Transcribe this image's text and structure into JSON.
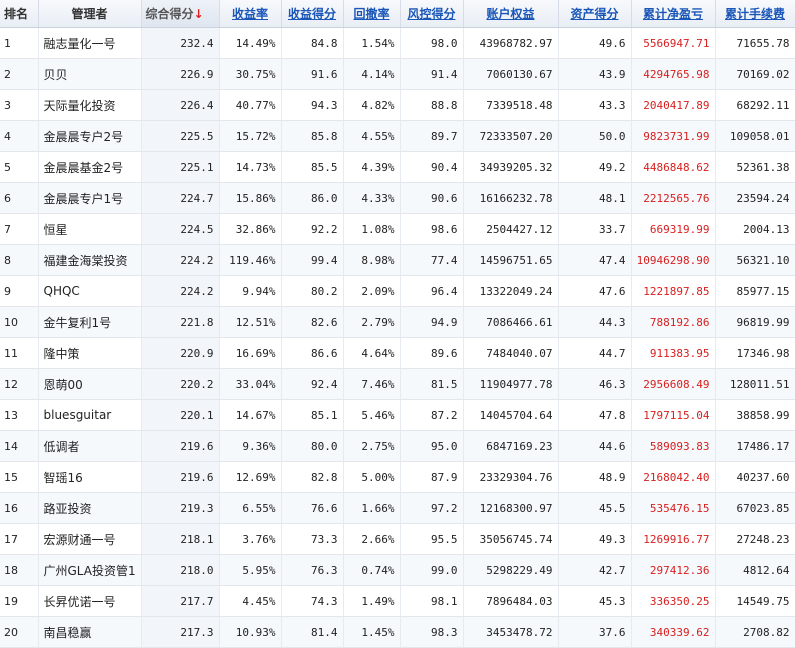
{
  "headers": {
    "rank": "排名",
    "manager": "管理者",
    "total_score": "综合得分",
    "sort_arrow": "↓",
    "return_rate": "收益率",
    "return_score": "收益得分",
    "drawdown": "回撤率",
    "risk_score": "风控得分",
    "equity": "账户权益",
    "asset_score": "资产得分",
    "cum_pnl": "累计净盈亏",
    "cum_fee": "累计手续费"
  },
  "colors": {
    "link": "#1a56b8",
    "profit": "#d81e1e",
    "arrow": "#e02020"
  },
  "rows": [
    {
      "rank": "1",
      "manager": "融志量化一号",
      "total": "232.4",
      "ret": "14.49%",
      "ret_score": "84.8",
      "dd": "1.54%",
      "risk": "98.0",
      "equity": "43968782.97",
      "asset": "49.6",
      "pnl": "5566947.71",
      "fee": "71655.78"
    },
    {
      "rank": "2",
      "manager": "贝贝",
      "total": "226.9",
      "ret": "30.75%",
      "ret_score": "91.6",
      "dd": "4.14%",
      "risk": "91.4",
      "equity": "7060130.67",
      "asset": "43.9",
      "pnl": "4294765.98",
      "fee": "70169.02"
    },
    {
      "rank": "3",
      "manager": "天际量化投资",
      "total": "226.4",
      "ret": "40.77%",
      "ret_score": "94.3",
      "dd": "4.82%",
      "risk": "88.8",
      "equity": "7339518.48",
      "asset": "43.3",
      "pnl": "2040417.89",
      "fee": "68292.11"
    },
    {
      "rank": "4",
      "manager": "金晨晨专户2号",
      "total": "225.5",
      "ret": "15.72%",
      "ret_score": "85.8",
      "dd": "4.55%",
      "risk": "89.7",
      "equity": "72333507.20",
      "asset": "50.0",
      "pnl": "9823731.99",
      "fee": "109058.01"
    },
    {
      "rank": "5",
      "manager": "金晨晨基金2号",
      "total": "225.1",
      "ret": "14.73%",
      "ret_score": "85.5",
      "dd": "4.39%",
      "risk": "90.4",
      "equity": "34939205.32",
      "asset": "49.2",
      "pnl": "4486848.62",
      "fee": "52361.38"
    },
    {
      "rank": "6",
      "manager": "金晨晨专户1号",
      "total": "224.7",
      "ret": "15.86%",
      "ret_score": "86.0",
      "dd": "4.33%",
      "risk": "90.6",
      "equity": "16166232.78",
      "asset": "48.1",
      "pnl": "2212565.76",
      "fee": "23594.24"
    },
    {
      "rank": "7",
      "manager": "恒星",
      "total": "224.5",
      "ret": "32.86%",
      "ret_score": "92.2",
      "dd": "1.08%",
      "risk": "98.6",
      "equity": "2504427.12",
      "asset": "33.7",
      "pnl": "669319.99",
      "fee": "2004.13"
    },
    {
      "rank": "8",
      "manager": "福建金海棠投资",
      "total": "224.2",
      "ret": "119.46%",
      "ret_score": "99.4",
      "dd": "8.98%",
      "risk": "77.4",
      "equity": "14596751.65",
      "asset": "47.4",
      "pnl": "10946298.90",
      "fee": "56321.10"
    },
    {
      "rank": "9",
      "manager": "QHQC",
      "total": "224.2",
      "ret": "9.94%",
      "ret_score": "80.2",
      "dd": "2.09%",
      "risk": "96.4",
      "equity": "13322049.24",
      "asset": "47.6",
      "pnl": "1221897.85",
      "fee": "85977.15"
    },
    {
      "rank": "10",
      "manager": "金牛复利1号",
      "total": "221.8",
      "ret": "12.51%",
      "ret_score": "82.6",
      "dd": "2.79%",
      "risk": "94.9",
      "equity": "7086466.61",
      "asset": "44.3",
      "pnl": "788192.86",
      "fee": "96819.99"
    },
    {
      "rank": "11",
      "manager": "隆中策",
      "total": "220.9",
      "ret": "16.69%",
      "ret_score": "86.6",
      "dd": "4.64%",
      "risk": "89.6",
      "equity": "7484040.07",
      "asset": "44.7",
      "pnl": "911383.95",
      "fee": "17346.98"
    },
    {
      "rank": "12",
      "manager": "恩萌00",
      "total": "220.2",
      "ret": "33.04%",
      "ret_score": "92.4",
      "dd": "7.46%",
      "risk": "81.5",
      "equity": "11904977.78",
      "asset": "46.3",
      "pnl": "2956608.49",
      "fee": "128011.51"
    },
    {
      "rank": "13",
      "manager": "bluesguitar",
      "total": "220.1",
      "ret": "14.67%",
      "ret_score": "85.1",
      "dd": "5.46%",
      "risk": "87.2",
      "equity": "14045704.64",
      "asset": "47.8",
      "pnl": "1797115.04",
      "fee": "38858.99"
    },
    {
      "rank": "14",
      "manager": "低调者",
      "total": "219.6",
      "ret": "9.36%",
      "ret_score": "80.0",
      "dd": "2.75%",
      "risk": "95.0",
      "equity": "6847169.23",
      "asset": "44.6",
      "pnl": "589093.83",
      "fee": "17486.17"
    },
    {
      "rank": "15",
      "manager": "智瑶16",
      "total": "219.6",
      "ret": "12.69%",
      "ret_score": "82.8",
      "dd": "5.00%",
      "risk": "87.9",
      "equity": "23329304.76",
      "asset": "48.9",
      "pnl": "2168042.40",
      "fee": "40237.60"
    },
    {
      "rank": "16",
      "manager": "路亚投资",
      "total": "219.3",
      "ret": "6.55%",
      "ret_score": "76.6",
      "dd": "1.66%",
      "risk": "97.2",
      "equity": "12168300.97",
      "asset": "45.5",
      "pnl": "535476.15",
      "fee": "67023.85"
    },
    {
      "rank": "17",
      "manager": "宏源财通一号",
      "total": "218.1",
      "ret": "3.76%",
      "ret_score": "73.3",
      "dd": "2.66%",
      "risk": "95.5",
      "equity": "35056745.74",
      "asset": "49.3",
      "pnl": "1269916.77",
      "fee": "27248.23"
    },
    {
      "rank": "18",
      "manager": "广州GLA投资管1",
      "total": "218.0",
      "ret": "5.95%",
      "ret_score": "76.3",
      "dd": "0.74%",
      "risk": "99.0",
      "equity": "5298229.49",
      "asset": "42.7",
      "pnl": "297412.36",
      "fee": "4812.64"
    },
    {
      "rank": "19",
      "manager": "长昇优诺一号",
      "total": "217.7",
      "ret": "4.45%",
      "ret_score": "74.3",
      "dd": "1.49%",
      "risk": "98.1",
      "equity": "7896484.03",
      "asset": "45.3",
      "pnl": "336350.25",
      "fee": "14549.75"
    },
    {
      "rank": "20",
      "manager": "南昌稳赢",
      "total": "217.3",
      "ret": "10.93%",
      "ret_score": "81.4",
      "dd": "1.45%",
      "risk": "98.3",
      "equity": "3453478.72",
      "asset": "37.6",
      "pnl": "340339.62",
      "fee": "2708.82"
    }
  ]
}
